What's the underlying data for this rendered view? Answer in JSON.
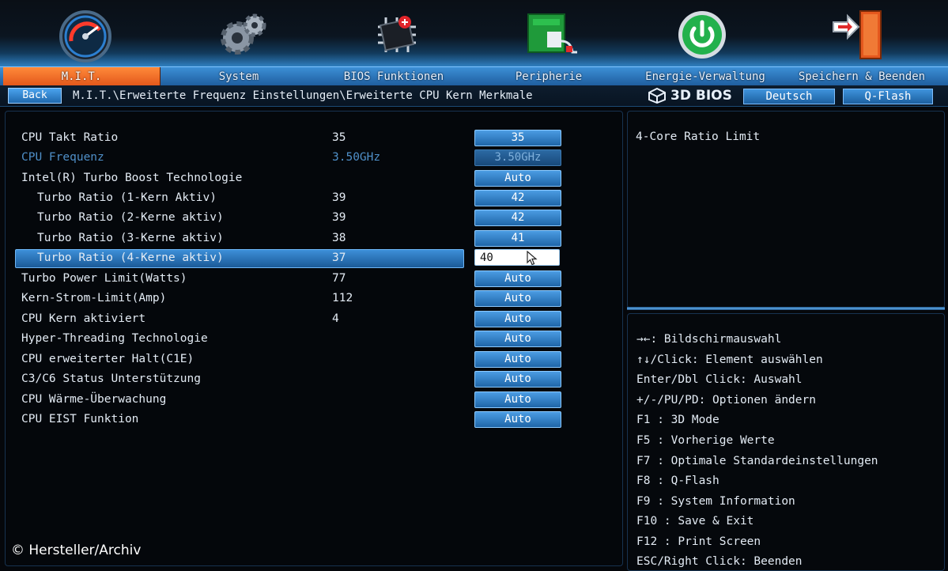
{
  "top_icons": [
    {
      "name": "speedometer-icon"
    },
    {
      "name": "gears-icon"
    },
    {
      "name": "chip-icon"
    },
    {
      "name": "peripheral-board-icon"
    },
    {
      "name": "power-icon"
    },
    {
      "name": "exit-door-icon"
    }
  ],
  "tabs": [
    {
      "label": "M.I.T.",
      "active": true
    },
    {
      "label": "System"
    },
    {
      "label": "BIOS Funktionen"
    },
    {
      "label": "Peripherie"
    },
    {
      "label": "Energie-Verwaltung"
    },
    {
      "label": "Speichern & Beenden"
    }
  ],
  "header": {
    "back_label": "Back",
    "breadcrumb": "M.I.T.\\Erweiterte Frequenz Einstellungen\\Erweiterte CPU Kern Merkmale",
    "logo_text": "3D BIOS",
    "language_label": "Deutsch",
    "qflash_label": "Q-Flash"
  },
  "settings": [
    {
      "label": "CPU Takt Ratio",
      "current": "35",
      "setting": "35"
    },
    {
      "label": "CPU Frequenz",
      "current": "3.50GHz",
      "setting": "3.50GHz",
      "dim": true
    },
    {
      "label": "Intel(R) Turbo Boost Technologie",
      "current": "",
      "setting": "Auto"
    },
    {
      "label": "Turbo Ratio (1-Kern Aktiv)",
      "current": "39",
      "setting": "42",
      "indent": true
    },
    {
      "label": "Turbo Ratio (2-Kerne aktiv)",
      "current": "39",
      "setting": "42",
      "indent": true
    },
    {
      "label": "Turbo Ratio (3-Kerne aktiv)",
      "current": "38",
      "setting": "41",
      "indent": true
    },
    {
      "label": "Turbo Ratio (4-Kerne aktiv)",
      "current": "37",
      "setting": "40",
      "indent": true,
      "selected": true
    },
    {
      "label": "Turbo Power Limit(Watts)",
      "current": "77",
      "setting": "Auto"
    },
    {
      "label": "Kern-Strom-Limit(Amp)",
      "current": "112",
      "setting": "Auto"
    },
    {
      "label": "CPU Kern aktiviert",
      "current": "4",
      "setting": "Auto"
    },
    {
      "label": "Hyper-Threading Technologie",
      "current": "",
      "setting": "Auto"
    },
    {
      "label": "CPU erweiterter Halt(C1E)",
      "current": "",
      "setting": "Auto"
    },
    {
      "label": "C3/C6 Status Unterstützung",
      "current": "",
      "setting": "Auto"
    },
    {
      "label": "CPU Wärme-Überwachung",
      "current": "",
      "setting": "Auto"
    },
    {
      "label": "CPU EIST Funktion",
      "current": "",
      "setting": "Auto"
    }
  ],
  "help": {
    "text": "4-Core Ratio Limit"
  },
  "key_help": [
    "→←: Bildschirmauswahl",
    "↑↓/Click: Element auswählen",
    "Enter/Dbl Click: Auswahl",
    "+/-/PU/PD: Optionen ändern",
    "F1  : 3D Mode",
    "F5  : Vorherige Werte",
    "F7  : Optimale Standardeinstellungen",
    "F8  : Q-Flash",
    "F9  : System Information",
    "F10 : Save & Exit",
    "F12 : Print Screen",
    "ESC/Right Click: Beenden"
  ],
  "watermark": "© Hersteller/Archiv",
  "colors": {
    "active_tab": "#e2561a",
    "accent_blue": "#2f7fc0",
    "background": "#05070b"
  }
}
